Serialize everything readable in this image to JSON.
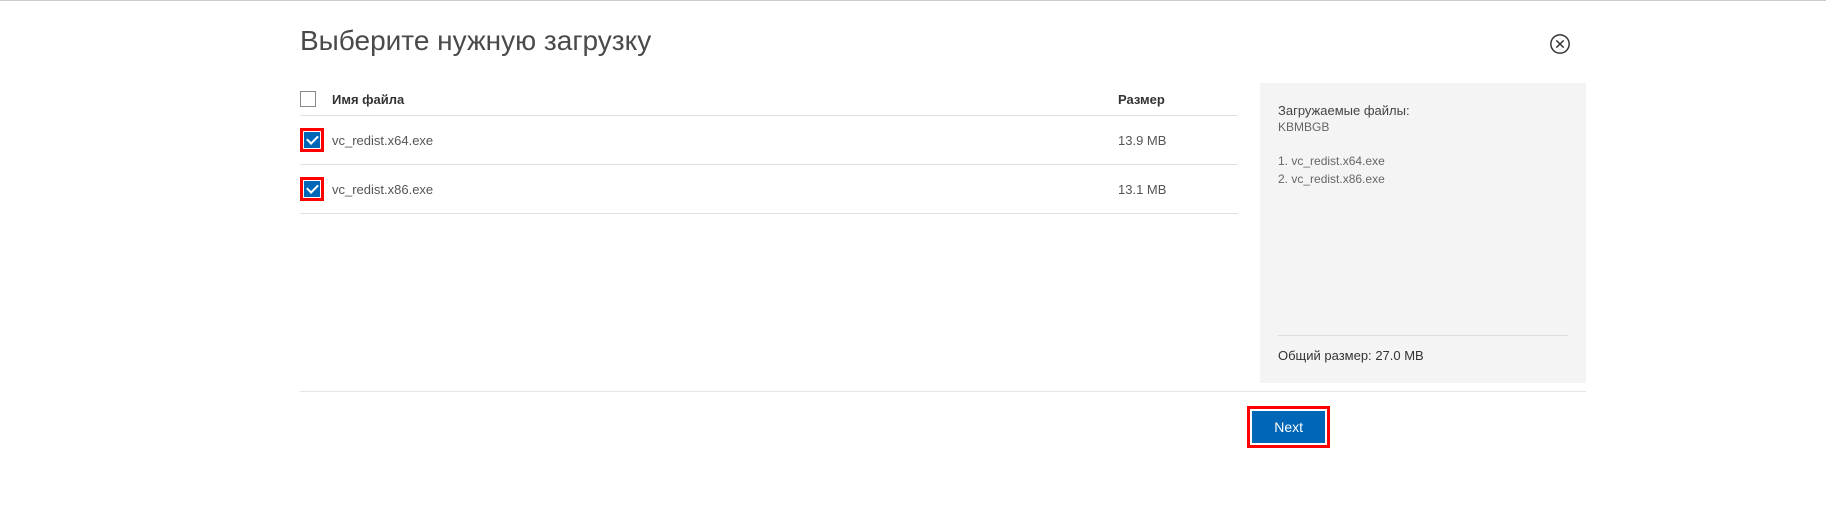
{
  "title": "Выберите нужную загрузку",
  "table": {
    "headers": {
      "name": "Имя файла",
      "size": "Размер"
    },
    "rows": [
      {
        "name": "vc_redist.x64.exe",
        "size": "13.9 MB",
        "checked": true
      },
      {
        "name": "vc_redist.x86.exe",
        "size": "13.1 MB",
        "checked": true
      }
    ]
  },
  "summary": {
    "title": "Загружаемые файлы:",
    "sub": "KBMBGB",
    "items": [
      {
        "idx": "1.",
        "name": "vc_redist.x64.exe"
      },
      {
        "idx": "2.",
        "name": "vc_redist.x86.exe"
      }
    ],
    "total_label": "Общий размер:",
    "total_value": "27.0 MB"
  },
  "buttons": {
    "next": "Next"
  }
}
